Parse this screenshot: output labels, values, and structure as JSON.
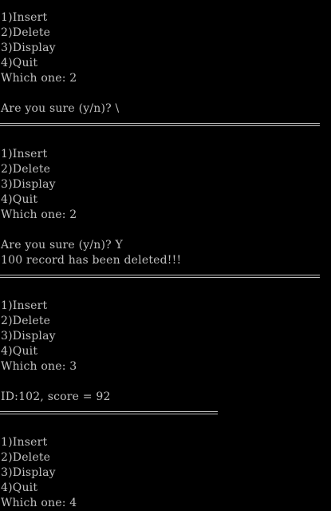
{
  "console": {
    "colors": {
      "background": "#000000",
      "text": "#c0c0c0"
    },
    "lines": [
      "1)Insert",
      "2)Delete",
      "3)Display",
      "4)Quit",
      "Which one: 2",
      "Are you sure (y/n)? \\",
      "1)Insert",
      "2)Delete",
      "3)Display",
      "4)Quit",
      "Which one: 2",
      "Are you sure (y/n)? Y",
      "100 record has been deleted!!!",
      "1)Insert",
      "2)Delete",
      "3)Display",
      "4)Quit",
      "Which one: 3",
      "ID:102, score = 92",
      "1)Insert",
      "2)Delete",
      "3)Display",
      "4)Quit",
      "Which one: 4"
    ]
  }
}
